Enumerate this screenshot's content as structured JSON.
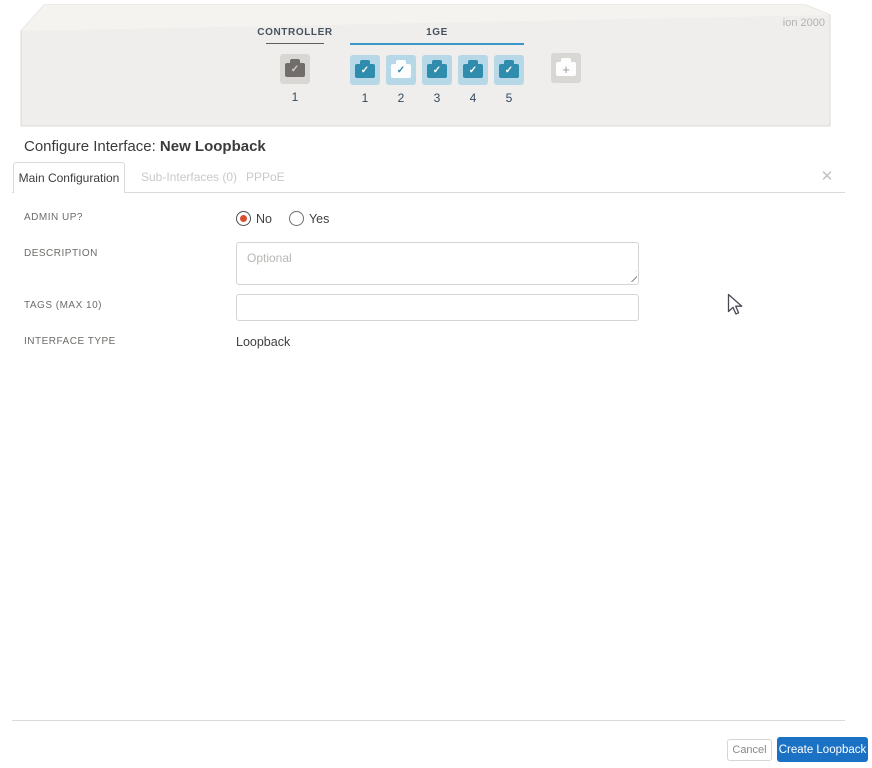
{
  "device": {
    "model_label": "ion 2000",
    "controller_group": {
      "label": "CONTROLLER",
      "ports": [
        {
          "number": "1",
          "variant": "gray"
        }
      ]
    },
    "one_ge_group": {
      "label": "1GE",
      "ports": [
        {
          "number": "1",
          "variant": "teal"
        },
        {
          "number": "2",
          "variant": "white"
        },
        {
          "number": "3",
          "variant": "teal"
        },
        {
          "number": "4",
          "variant": "teal"
        },
        {
          "number": "5",
          "variant": "teal"
        }
      ]
    },
    "add_port": {
      "glyph": "+"
    },
    "port_check_glyph": "✓"
  },
  "dialog": {
    "title_prefix": "Configure Interface: ",
    "title_name": "New Loopback",
    "tabs": [
      {
        "label": "Main Configuration",
        "active": true
      },
      {
        "label": "Sub-Interfaces (0)",
        "active": false
      },
      {
        "label": "PPPoE",
        "active": false
      }
    ],
    "close_glyph": "✕"
  },
  "form": {
    "admin_up": {
      "label": "ADMIN UP?",
      "options": [
        {
          "label": "No",
          "selected": true
        },
        {
          "label": "Yes",
          "selected": false
        }
      ]
    },
    "description": {
      "label": "DESCRIPTION",
      "placeholder": "Optional",
      "value": ""
    },
    "tags": {
      "label": "TAGS (MAX 10)",
      "value": ""
    },
    "interface_type": {
      "label": "INTERFACE TYPE",
      "value": "Loopback"
    }
  },
  "footer": {
    "cancel_label": "Cancel",
    "submit_label": "Create Loopback"
  },
  "colors": {
    "port_teal": "#2f8cad",
    "port_bg_blue": "#b7d8e6",
    "port_gray": "#716d6a",
    "group_underline_blue": "#3b97c6",
    "group_underline_dark": "#5c5c5c",
    "radio_selected_red": "#d9502e",
    "submit_blue": "#1b72c4",
    "device_face": "#efeeec",
    "device_top_face": "#f4f3f0"
  }
}
